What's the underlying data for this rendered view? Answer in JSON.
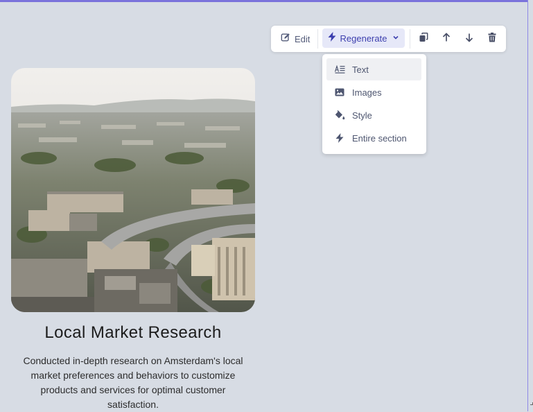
{
  "toolbar": {
    "edit_label": "Edit",
    "regenerate_label": "Regenerate",
    "icons": [
      "edit-icon",
      "bolt-icon",
      "chevron-down-icon",
      "duplicate-icon",
      "arrow-up-icon",
      "arrow-down-icon",
      "trash-icon"
    ]
  },
  "regenerate_menu": {
    "items": [
      {
        "label": "Text",
        "icon": "text-icon"
      },
      {
        "label": "Images",
        "icon": "image-icon"
      },
      {
        "label": "Style",
        "icon": "paint-bucket-icon"
      },
      {
        "label": "Entire section",
        "icon": "bolt-icon"
      }
    ]
  },
  "card": {
    "title": "Local Market Research",
    "description": "Conducted in-depth research on Amsterdam's local market preferences and behaviors to customize products and services for optimal customer satisfaction."
  },
  "colors": {
    "background": "#d7dce4",
    "accent": "#7b73db",
    "regenerate_bg": "#e6e8f8",
    "regenerate_text": "#3d3fae"
  }
}
